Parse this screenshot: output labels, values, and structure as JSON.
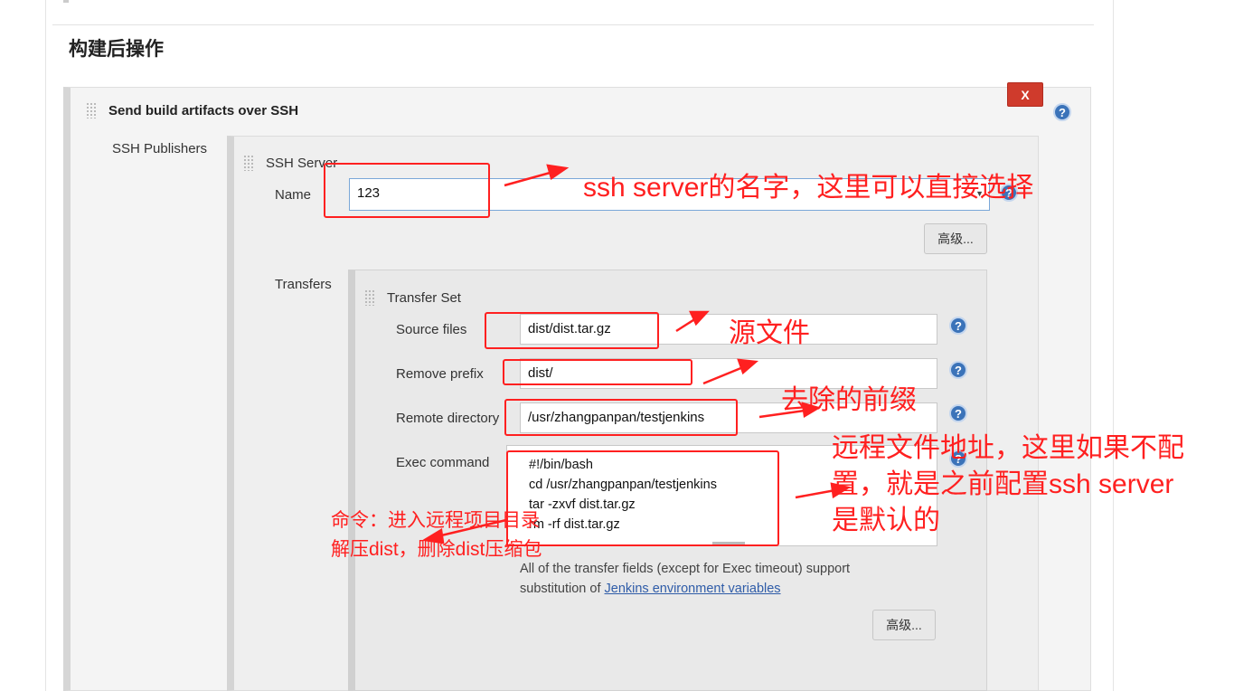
{
  "section": {
    "title": "构建后操作"
  },
  "step": {
    "title": "Send build artifacts over SSH",
    "delete_label": "X",
    "help": "?"
  },
  "ssh_publishers": {
    "label": "SSH Publishers",
    "server": {
      "title": "SSH Server",
      "name_label": "Name",
      "name_value": "123",
      "advanced_label": "高级...",
      "help": "?"
    },
    "transfers": {
      "label": "Transfers",
      "set_title": "Transfer Set",
      "source_files_label": "Source files",
      "source_files_value": "dist/dist.tar.gz",
      "remove_prefix_label": "Remove prefix",
      "remove_prefix_value": "dist/",
      "remote_directory_label": "Remote directory",
      "remote_directory_value": "/usr/zhangpanpan/testjenkins",
      "exec_command_label": "Exec command",
      "exec_command_value": "#!/bin/bash\ncd /usr/zhangpanpan/testjenkins\ntar -zxvf dist.tar.gz\nrm -rf dist.tar.gz",
      "hint_line1": "All of the transfer fields (except for Exec timeout) support",
      "hint_line2_prefix": "substitution of ",
      "hint_link": "Jenkins environment variables",
      "advanced_label": "高级...",
      "help": "?"
    }
  },
  "annotations": {
    "name_note": "ssh server的名字，这里可以直接选择",
    "source_note": "源文件",
    "prefix_note": "去除的前缀",
    "remote_note_line1": "远程文件地址，这里如果不配",
    "remote_note_line2": "置，就是之前配置ssh server",
    "remote_note_line3": "是默认的",
    "exec_note_line1": "命令：进入远程项目目录",
    "exec_note_line2": "解压dist，删除dist压缩包"
  },
  "colors": {
    "annotation": "#ff2020",
    "help_icon": "#3b73b9",
    "delete_button": "#cf3b2c",
    "link": "#2f5ca8"
  }
}
